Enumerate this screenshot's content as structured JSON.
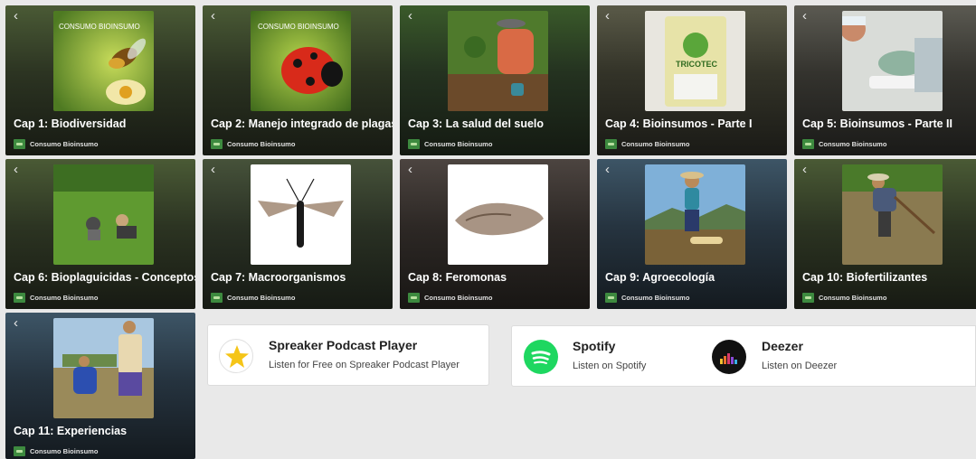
{
  "publisher": "Consumo Bioinsumo",
  "back_glyph": "‹",
  "episodes": [
    {
      "title": "Cap 1: Biodiversidad",
      "art_text": "CONSUMO BIOINSUMO"
    },
    {
      "title": "Cap 2: Manejo integrado de plagas",
      "art_text": "CONSUMO BIOINSUMO"
    },
    {
      "title": "Cap 3: La salud del suelo"
    },
    {
      "title": "Cap 4: Bioinsumos - Parte I",
      "art_text": "TRICOTEC"
    },
    {
      "title": "Cap 5: Bioinsumos - Parte II"
    },
    {
      "title": "Cap 6: Bioplaguicidas - Conceptos"
    },
    {
      "title": "Cap 7: Macroorganismos"
    },
    {
      "title": "Cap 8: Feromonas"
    },
    {
      "title": "Cap 9: Agroecología"
    },
    {
      "title": "Cap 10: Biofertilizantes"
    },
    {
      "title": "Cap 11: Experiencias"
    }
  ],
  "services": {
    "spreaker": {
      "name": "Spreaker Podcast Player",
      "sub": "Listen for Free on Spreaker Podcast Player",
      "icon": "star-icon",
      "color": "#f5c518"
    },
    "spotify": {
      "name": "Spotify",
      "sub": "Listen on Spotify",
      "icon": "spotify-icon",
      "color": "#1ed760"
    },
    "deezer": {
      "name": "Deezer",
      "sub": "Listen on Deezer",
      "icon": "deezer-icon",
      "color": "#111111"
    }
  }
}
